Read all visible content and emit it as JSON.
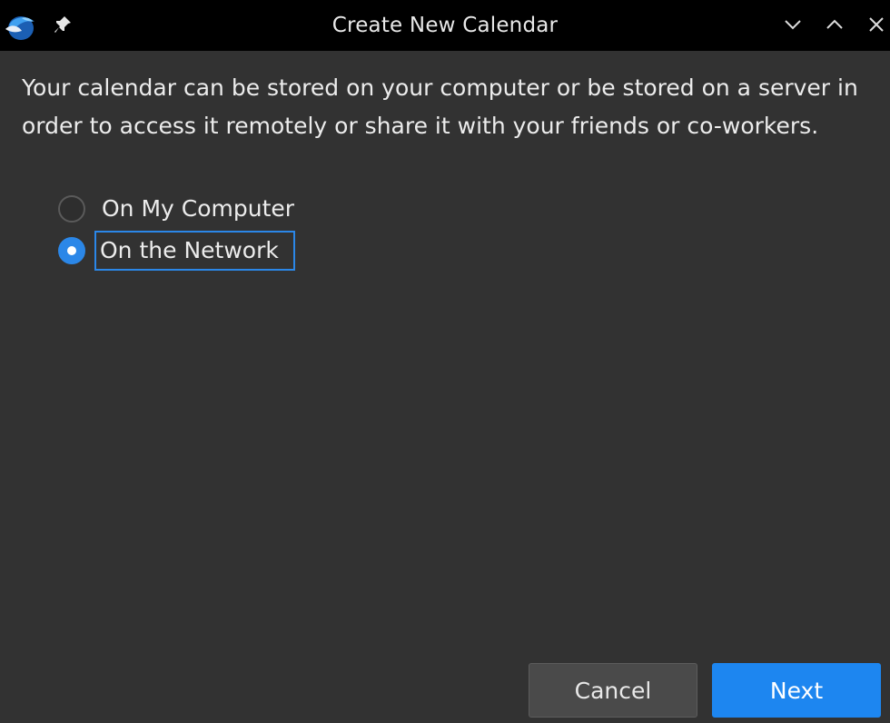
{
  "window": {
    "title": "Create New Calendar"
  },
  "titlebar": {
    "icons": {
      "app": "thunderbird-app-icon",
      "pin": "pin-icon",
      "minimize": "chevron-down-icon",
      "maximize": "chevron-up-icon",
      "close": "close-icon"
    }
  },
  "main": {
    "description": "Your calendar can be stored on your computer or be stored on a server in order to access it remotely or share it with your friends or co-workers.",
    "options": [
      {
        "label": "On My Computer",
        "selected": false
      },
      {
        "label": "On the Network",
        "selected": true
      }
    ]
  },
  "footer": {
    "cancel_label": "Cancel",
    "next_label": "Next"
  },
  "colors": {
    "accent": "#2b87e8",
    "background": "#323232",
    "titlebar": "#000000"
  }
}
